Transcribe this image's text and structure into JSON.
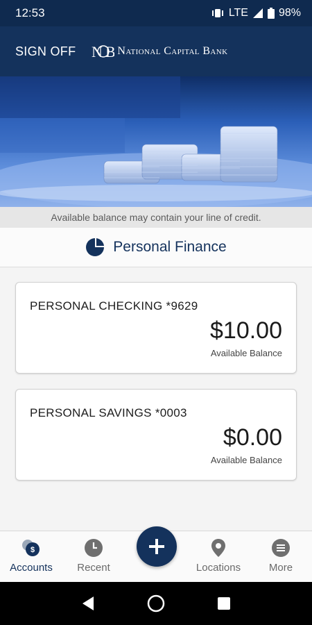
{
  "status_bar": {
    "time": "12:53",
    "network": "LTE",
    "battery": "98%"
  },
  "header": {
    "sign_off_label": "SIGN OFF",
    "bank_name": "National Capital Bank",
    "logo_monogram": "NCB",
    "background_color": "#14325c"
  },
  "notice": {
    "text": "Available balance may contain your line of credit."
  },
  "section": {
    "icon": "pie-chart-icon",
    "title": "Personal Finance"
  },
  "accounts": [
    {
      "name": "PERSONAL CHECKING *9629",
      "balance": "$10.00",
      "balance_label": "Available Balance"
    },
    {
      "name": "PERSONAL SAVINGS *0003",
      "balance": "$0.00",
      "balance_label": "Available Balance"
    }
  ],
  "bottom_nav": {
    "items": [
      {
        "label": "Accounts",
        "icon": "accounts-icon",
        "badge": "$",
        "active": true
      },
      {
        "label": "Recent",
        "icon": "clock-icon"
      },
      {
        "label": "Locations",
        "icon": "location-pin-icon"
      },
      {
        "label": "More",
        "icon": "more-menu-icon"
      }
    ],
    "fab_icon": "plus-icon"
  },
  "system_nav": {
    "buttons": [
      "back-icon",
      "home-icon",
      "recents-icon"
    ]
  },
  "colors": {
    "primary": "#14325c",
    "status_bar": "#0f2a4f"
  }
}
